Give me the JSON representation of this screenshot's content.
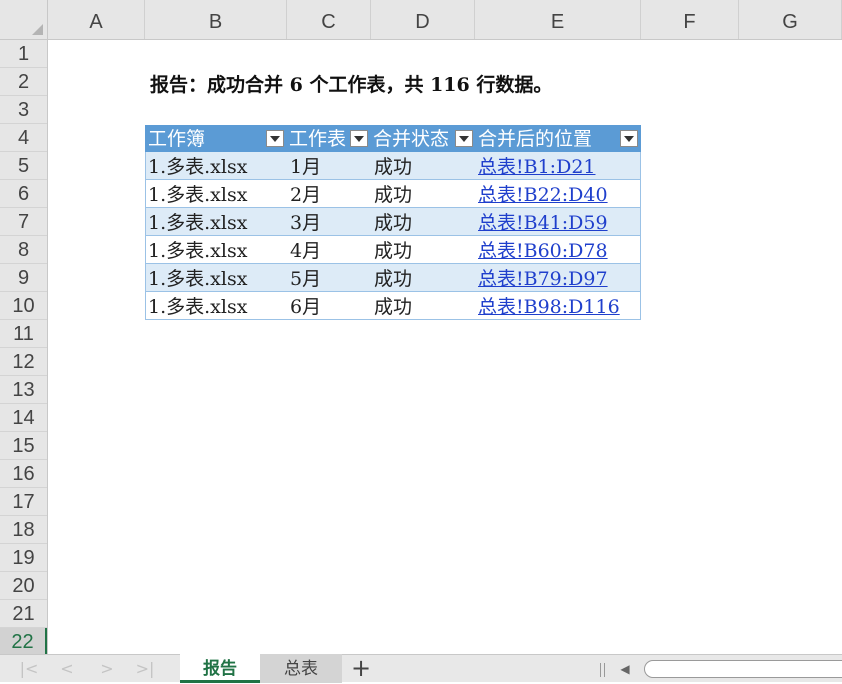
{
  "columns": [
    "A",
    "B",
    "C",
    "D",
    "E",
    "F",
    "G"
  ],
  "rows": [
    "1",
    "2",
    "3",
    "4",
    "5",
    "6",
    "7",
    "8",
    "9",
    "10",
    "11",
    "12",
    "13",
    "14",
    "15",
    "16",
    "17",
    "18",
    "19",
    "20",
    "21",
    "22"
  ],
  "active_row": "22",
  "report": {
    "title": "报告：成功合并 6 个工作表，共 116 行数据。"
  },
  "table": {
    "headers": [
      "工作簿",
      "工作表",
      "合并状态",
      "合并后的位置"
    ],
    "rows": [
      {
        "workbook": "1.多表.xlsx",
        "sheet": "1月",
        "status": "成功",
        "location": "总表!B1:D21"
      },
      {
        "workbook": "1.多表.xlsx",
        "sheet": "2月",
        "status": "成功",
        "location": "总表!B22:D40"
      },
      {
        "workbook": "1.多表.xlsx",
        "sheet": "3月",
        "status": "成功",
        "location": "总表!B41:D59"
      },
      {
        "workbook": "1.多表.xlsx",
        "sheet": "4月",
        "status": "成功",
        "location": "总表!B60:D78"
      },
      {
        "workbook": "1.多表.xlsx",
        "sheet": "5月",
        "status": "成功",
        "location": "总表!B79:D97"
      },
      {
        "workbook": "1.多表.xlsx",
        "sheet": "6月",
        "status": "成功",
        "location": "总表!B98:D116"
      }
    ]
  },
  "tabs": {
    "nav": [
      "|<",
      "<",
      ">",
      ">|"
    ],
    "sheets": [
      {
        "label": "报告",
        "active": true
      },
      {
        "label": "总表",
        "active": false
      }
    ],
    "add": "+",
    "scroll_left": "◀"
  },
  "colors": {
    "header_blue": "#5b9bd5",
    "band_blue": "#ddebf7",
    "accent_green": "#217346",
    "link": "#1f3fcc"
  }
}
